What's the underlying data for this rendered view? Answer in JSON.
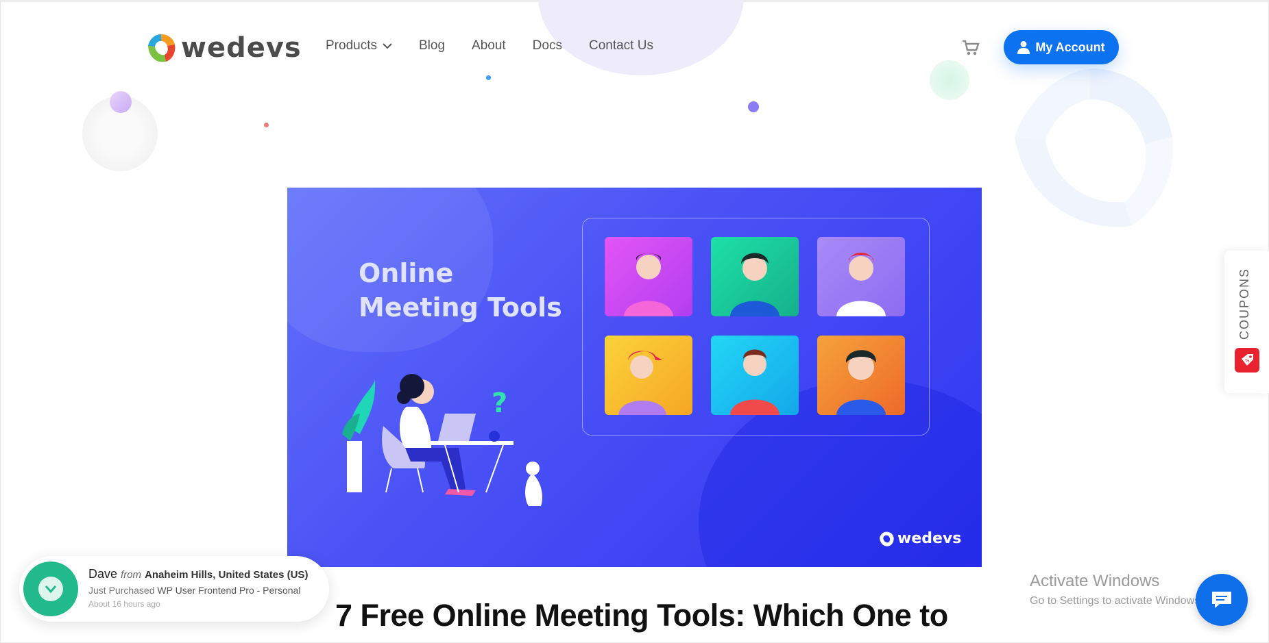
{
  "header": {
    "logo_text": "wedevs",
    "nav": [
      {
        "label": "Products"
      },
      {
        "label": "Blog"
      },
      {
        "label": "About"
      },
      {
        "label": "Docs"
      },
      {
        "label": "Contact Us"
      }
    ],
    "account_label": "My Account"
  },
  "banner": {
    "title_line1": "Online",
    "title_line2": "Meeting Tools",
    "logo_text": "wedevs",
    "tile_colors": [
      "#d846f0",
      "#1fc6a2",
      "#9c7cf5",
      "#f6b824",
      "#1ec6f0",
      "#f0812b"
    ]
  },
  "article": {
    "title": "7 Free Online Meeting Tools: Which One to"
  },
  "coupons": {
    "label": "COUPONS"
  },
  "popup": {
    "name": "Dave",
    "from_word": "from",
    "location": "Anaheim Hills, United States (US)",
    "action": "Just Purchased",
    "product": "WP User Frontend Pro - Personal",
    "time": "About 16 hours ago"
  },
  "os_watermark": {
    "title": "Activate Windows",
    "subtitle": "Go to Settings to activate Windows."
  },
  "colors": {
    "accent": "#0d72f0",
    "banner": "#4b52f5",
    "popup_avatar": "#22b98c",
    "coupon": "#e8232f"
  }
}
